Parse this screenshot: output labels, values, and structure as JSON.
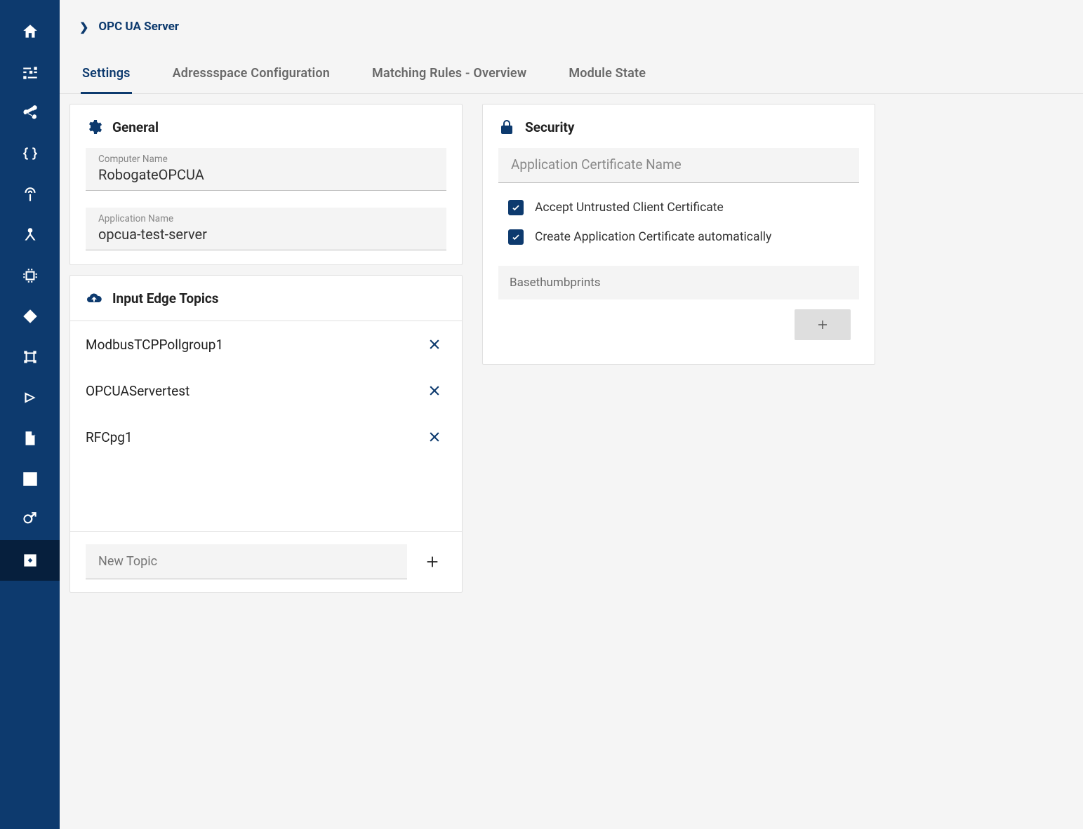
{
  "breadcrumb": {
    "title": "OPC UA Server"
  },
  "tabs": [
    {
      "label": "Settings",
      "active": true
    },
    {
      "label": "Adressspace Configuration",
      "active": false
    },
    {
      "label": "Matching Rules - Overview",
      "active": false
    },
    {
      "label": "Module State",
      "active": false
    }
  ],
  "general": {
    "title": "General",
    "computer_name_label": "Computer Name",
    "computer_name_value": "RobogateOPCUA",
    "application_name_label": "Application Name",
    "application_name_value": "opcua-test-server"
  },
  "input_edge_topics": {
    "title": "Input Edge Topics",
    "items": [
      "ModbusTCPPollgroup1",
      "OPCUAServertest",
      "RFCpg1"
    ],
    "new_topic_placeholder": "New Topic"
  },
  "security": {
    "title": "Security",
    "app_cert_placeholder": "Application Certificate Name",
    "app_cert_value": "",
    "accept_untrusted_label": "Accept Untrusted Client Certificate",
    "accept_untrusted_checked": true,
    "auto_create_cert_label": "Create Application Certificate automatically",
    "auto_create_cert_checked": true,
    "basethumbprints_label": "Basethumbprints"
  },
  "sidebar_icons": [
    "home-icon",
    "sliders-icon",
    "share-icon",
    "braces-icon",
    "antenna-icon",
    "tripod-icon",
    "chip-icon",
    "diamond-icon",
    "integration-icon",
    "angle-icon",
    "file-icon",
    "stripes-icon",
    "gear-male-icon",
    "module-icon"
  ]
}
